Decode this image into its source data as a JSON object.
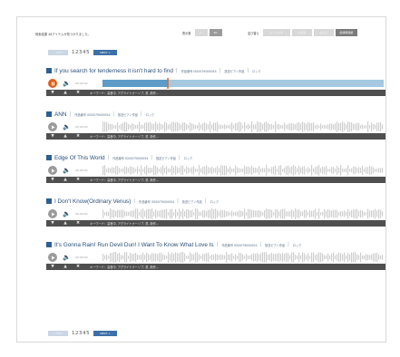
{
  "header": {
    "result_text": "検索結果 48アイテムが見つかりました。",
    "display_label": "表示数",
    "display_options": [
      {
        "label": "20",
        "state": "off"
      },
      {
        "label": "50",
        "state": "on"
      }
    ],
    "sort_label": "並び替え",
    "sort_options": [
      {
        "label": "おすすめ順",
        "state": "off"
      },
      {
        "label": "新着順",
        "state": "off"
      },
      {
        "label": "曲名順",
        "state": "off"
      },
      {
        "label": "収録時間順",
        "state": "dark"
      }
    ]
  },
  "pager": {
    "prev_label": "< PREV",
    "pages": "12345",
    "next_label": "NEXT >"
  },
  "tracks": [
    {
      "title": "If you search for tenderness it isn't hard to find",
      "number": "作品番号 IS00079000054",
      "artist": "放送ピアノ作品",
      "genre": "ロック",
      "time": "00:00:00",
      "playing": true,
      "progress": 0.23,
      "keywords": "キーワード：高音中, アグライトナーソプ, 重, 新作..."
    },
    {
      "title": "ANN",
      "number": "作品番号 IS00079000054",
      "artist": "放送ピアノ作品",
      "genre": "ロック",
      "time": "00:00:00",
      "playing": false,
      "progress": 0,
      "keywords": "キーワード：高音中, アグライトナーソプ, 重, 新作..."
    },
    {
      "title": "Edge Of This World",
      "number": "作品番号 IS00079000054",
      "artist": "放送ピアノ作品",
      "genre": "ロック",
      "time": "00:00:00",
      "playing": false,
      "progress": 0,
      "keywords": "キーワード：高音中, アグライトナーソプ, 重, 新作..."
    },
    {
      "title": "I Don't Know(Ordinary Venus)",
      "number": "作品番号 IS00079000054",
      "artist": "放送ピアノ作品",
      "genre": "ロック",
      "time": "00:00:00",
      "playing": false,
      "progress": 0,
      "keywords": "キーワード：高音中, アグライトナーソプ, 重, 新作..."
    },
    {
      "title": "It's Gonna Rain! Run Devil Dun! I Want To Know What Love Is",
      "number": "作品番号 IS00079000054",
      "artist": "放送ピアノ作品",
      "genre": "ロック",
      "time": "00:00:00",
      "playing": false,
      "progress": 0,
      "keywords": "キーワード：高音中, アグライトナーソプ, 重, 新作..."
    }
  ],
  "colors": {
    "accent": "#2d5f93",
    "play_active": "#e0601a",
    "wave_active": "#5d9bc8",
    "wave_idle": "#cfcfcf",
    "bar": "#4f4f4f"
  },
  "icons": {
    "play": "play-icon",
    "pause": "pause-icon",
    "volume": "volume-icon",
    "download": "download-icon",
    "cart": "cart-icon",
    "share": "share-icon"
  }
}
